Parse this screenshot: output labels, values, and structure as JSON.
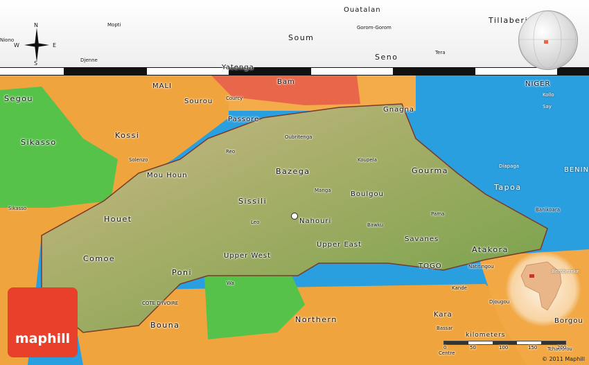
{
  "map": {
    "brand": "maphill",
    "copyright": "© 2011 Maphill",
    "scale_label": "kilometers",
    "scale_ticks": [
      "0",
      "50",
      "100",
      "150",
      "200"
    ],
    "compass": {
      "n": "N",
      "s": "S",
      "e": "E",
      "w": "W"
    },
    "colors": {
      "highlight_land": "#a7a56a",
      "orange_region": "#f0a43d",
      "green_region": "#57c24a",
      "blue_region": "#2a9fe0",
      "red_region": "#e8674a",
      "logo": "#e8402a"
    },
    "top_labels": [
      "Ouatalan",
      "Mopti",
      "Niono",
      "Djenne",
      "Soum",
      "Gorom-Gorom",
      "Seno",
      "Tera",
      "Tillaberi",
      "Yatenga"
    ],
    "labels": {
      "mali": "MALI",
      "bam": "Bam",
      "niger": "NIGER",
      "kollo": "Kollo",
      "say": "Say",
      "segou": "Segou",
      "sourou": "Sourou",
      "courcy": "Courcy",
      "gnagna": "Gnagna",
      "passore": "Passore",
      "kossi": "Kossi",
      "oubritenga": "Oubritenga",
      "sikasso": "Sikasso",
      "reo": "Reo",
      "solenzo": "Solenzo",
      "koupela": "Koupela",
      "bazega": "Bazega",
      "gourma": "Gourma",
      "diapaga": "Diapaga",
      "benin": "BENIN",
      "mou_houn": "Mou Houn",
      "tapoa": "Tapoa",
      "manga": "Manga",
      "boulgou": "Boulgou",
      "sissili": "Sissili",
      "sikasso_town": "Sikasso",
      "banikoara": "Banikoara",
      "houet": "Houet",
      "leo": "Leo",
      "nahouri": "Nahouri",
      "pama": "Pama",
      "bawku": "Bawku",
      "savanes": "Savanes",
      "upper_east": "Upper East",
      "atakora": "Atakora",
      "comoe": "Comoe",
      "upper_west": "Upper West",
      "togo": "TOGO",
      "natitingou": "Natitingou",
      "poni": "Poni",
      "wa": "Wa",
      "kande": "Kande",
      "djougou": "Djougou",
      "bembereke": "Bembereke",
      "cote_divoire": "COTE D'IVOIRE",
      "bouna": "Bouna",
      "northern": "Northern",
      "kara": "Kara",
      "bassar": "Bassar",
      "borgou": "Borgou",
      "centre": "Centre",
      "tchaourou": "Tchaourou"
    }
  }
}
